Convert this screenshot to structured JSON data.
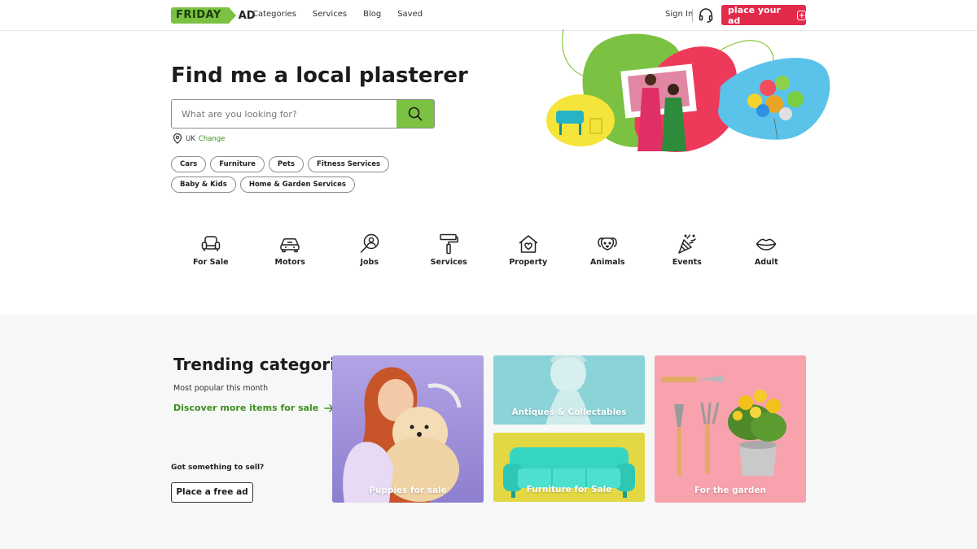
{
  "header": {
    "logo": {
      "left": "FRIDAY",
      "right": "AD"
    },
    "nav": [
      "Categories",
      "Services",
      "Blog",
      "Saved"
    ],
    "sign_in": "Sign In",
    "place_ad": "place your ad",
    "icons": {
      "support": "headset-icon",
      "add": "plus-square-icon"
    }
  },
  "hero": {
    "title": "Find me a local plasterer",
    "search": {
      "placeholder": "What are you looking for?",
      "value": ""
    },
    "location": {
      "country": "UK",
      "change": "Change"
    },
    "chips": [
      "Cars",
      "Furniture",
      "Pets",
      "Fitness Services",
      "Baby & Kids",
      "Home & Garden Services"
    ]
  },
  "categories": [
    {
      "label": "For Sale",
      "icon": "armchair-icon"
    },
    {
      "label": "Motors",
      "icon": "car-icon"
    },
    {
      "label": "Jobs",
      "icon": "person-search-icon"
    },
    {
      "label": "Services",
      "icon": "paint-roller-icon"
    },
    {
      "label": "Property",
      "icon": "house-heart-icon"
    },
    {
      "label": "Animals",
      "icon": "dog-icon"
    },
    {
      "label": "Events",
      "icon": "party-popper-icon"
    },
    {
      "label": "Adult",
      "icon": "lips-icon"
    }
  ],
  "trending": {
    "title": "Trending categories",
    "subtitle": "Most popular this month",
    "discover_link": "Discover more items for sale",
    "sell_prompt": "Got something to sell?",
    "free_ad_button": "Place a free ad",
    "cards": [
      {
        "label": "Puppies for sale"
      },
      {
        "label": "Antiques & Collectables"
      },
      {
        "label": "Furniture for Sale"
      },
      {
        "label": "For the garden"
      }
    ]
  },
  "colors": {
    "brand_green": "#7cc242",
    "link_green": "#3e8e1f",
    "accent_red": "#e22a4a",
    "section_bg": "#f6f7f7"
  }
}
